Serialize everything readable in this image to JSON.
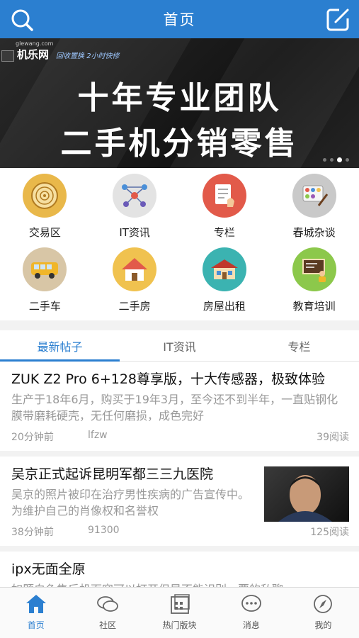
{
  "header": {
    "title": "首页",
    "search_icon": "search-icon",
    "edit_icon": "compose-icon"
  },
  "banner": {
    "site_small": "glewang.com",
    "brand": "机乐网",
    "slogan": "回收置换 2小时快修",
    "line1": "十年专业团队",
    "line2": "二手机分销零售",
    "dot_count": 4,
    "active_dot": 3
  },
  "categories": [
    {
      "label": "交易区",
      "icon": "vinyl-record-icon",
      "color": "#e9b84a"
    },
    {
      "label": "IT资讯",
      "icon": "network-icon",
      "color": "#e3e3e3"
    },
    {
      "label": "专栏",
      "icon": "document-hand-icon",
      "color": "#e25a4a"
    },
    {
      "label": "春城杂谈",
      "icon": "palette-icon",
      "color": "#c9c9c9"
    },
    {
      "label": "二手车",
      "icon": "bus-icon",
      "color": "#d8c6a6"
    },
    {
      "label": "二手房",
      "icon": "house-icon",
      "color": "#f0c24f"
    },
    {
      "label": "房屋出租",
      "icon": "rental-house-icon",
      "color": "#3bb3b1"
    },
    {
      "label": "教育培训",
      "icon": "teacher-board-icon",
      "color": "#8cc84b"
    }
  ],
  "tabs": [
    {
      "label": "最新帖子",
      "active": true
    },
    {
      "label": "IT资讯",
      "active": false
    },
    {
      "label": "专栏",
      "active": false
    }
  ],
  "posts": [
    {
      "title": "ZUK Z2 Pro 6+128尊享版，十大传感器，极致体验",
      "excerpt": "生产于18年6月，购买于19年3月，至今还不到半年，一直贴钢化膜带磨耗硬壳，无任何磨损，成色完好",
      "time": "20分钟前",
      "author": "lfzw",
      "reads": "39阅读"
    },
    {
      "title": "吴京正式起诉昆明军都三三九医院",
      "excerpt": "吴京的照片被印在治疗男性疾病的广告宣传中。为维护自己的肖像权和名誉权",
      "time": "38分钟前",
      "author": "91300",
      "reads": "125阅读"
    },
    {
      "title": "ipx无面全原",
      "excerpt": "如题白色售后机面容可以打开但是不能识别，要的私聊",
      "time": "",
      "author": "",
      "reads": ""
    }
  ],
  "tabbar": [
    {
      "label": "首页",
      "icon": "home-icon",
      "active": true
    },
    {
      "label": "社区",
      "icon": "community-chat-icon",
      "active": false
    },
    {
      "label": "热门版块",
      "icon": "grid-board-icon",
      "active": false
    },
    {
      "label": "消息",
      "icon": "message-icon",
      "active": false
    },
    {
      "label": "我的",
      "icon": "compass-profile-icon",
      "active": false
    }
  ],
  "colors": {
    "accent": "#2b7fd0",
    "muted_text": "#999999"
  }
}
